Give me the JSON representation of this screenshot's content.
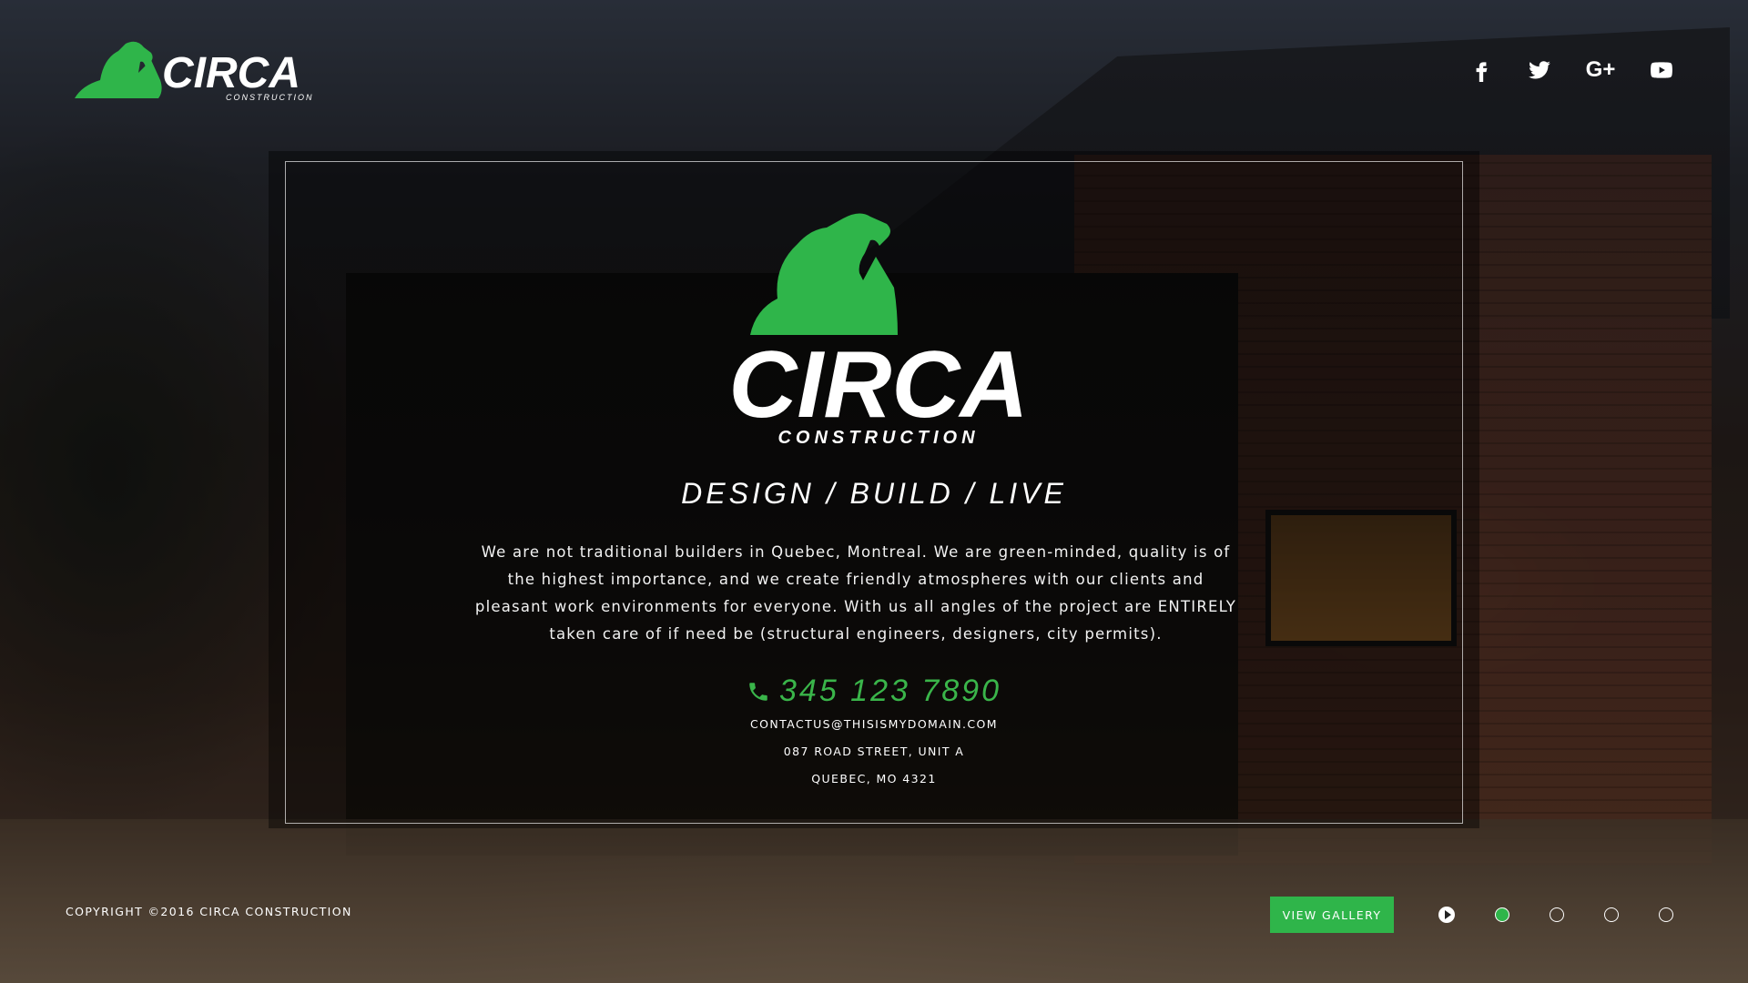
{
  "brand": {
    "name": "CIRCA",
    "subtitle": "CONSTRUCTION",
    "accent_color": "#2fb54a"
  },
  "social": [
    {
      "name": "facebook-icon",
      "glyph": "f"
    },
    {
      "name": "twitter-icon",
      "glyph": "twitter"
    },
    {
      "name": "google-plus-icon",
      "glyph": "G+"
    },
    {
      "name": "youtube-icon",
      "glyph": "youtube"
    }
  ],
  "hero": {
    "tagline": "DESIGN / BUILD / LIVE",
    "description": "We are not traditional builders in Quebec, Montreal. We are green-minded, quality is of the highest importance, and we create friendly atmospheres with our clients and pleasant work environments for everyone. With us all angles of the project are ENTIRELY taken care of if need be (structural engineers, designers, city permits).",
    "phone": "345 123 7890",
    "email": "CONTACTUS@THISISMYDOMAIN.COM",
    "street": "087 ROAD STREET, UNIT A",
    "city": "QUEBEC, MO 4321"
  },
  "footer": {
    "copyright": "COPYRIGHT ©2016 CIRCA CONSTRUCTION",
    "gallery_button": "VIEW GALLERY",
    "slides_count": 4,
    "active_slide": 1
  }
}
